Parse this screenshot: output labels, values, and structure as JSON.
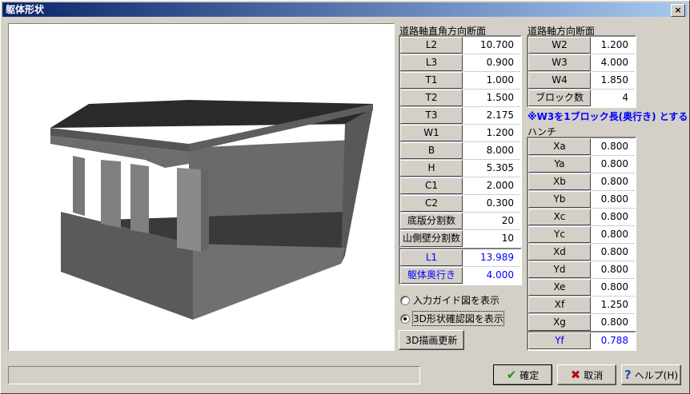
{
  "window": {
    "title": "躯体形状",
    "close": "×"
  },
  "left": {
    "heading": "道路軸直角方向断面",
    "rows": [
      {
        "label": "L2",
        "value": "10.700"
      },
      {
        "label": "L3",
        "value": "0.900"
      },
      {
        "label": "T1",
        "value": "1.000"
      },
      {
        "label": "T2",
        "value": "1.500"
      },
      {
        "label": "T3",
        "value": "2.175"
      },
      {
        "label": "W1",
        "value": "1.200"
      },
      {
        "label": "B",
        "value": "8.000"
      },
      {
        "label": "H",
        "value": "5.305"
      },
      {
        "label": "C1",
        "value": "2.000"
      },
      {
        "label": "C2",
        "value": "0.300"
      },
      {
        "label": "底版分割数",
        "value": "20"
      },
      {
        "label": "山側壁分割数",
        "value": "10"
      }
    ],
    "computed": [
      {
        "label": "L1",
        "value": "13.989"
      },
      {
        "label": "躯体奥行き",
        "value": "4.000"
      }
    ]
  },
  "right": {
    "heading": "道路軸方向断面",
    "rows": [
      {
        "label": "W2",
        "value": "1.200"
      },
      {
        "label": "W3",
        "value": "4.000"
      },
      {
        "label": "W4",
        "value": "1.850"
      },
      {
        "label": "ブロック数",
        "value": "4"
      }
    ],
    "note": "※W3を1ブロック長(奥行き) とする",
    "haunch_heading": "ハンチ",
    "haunch": [
      {
        "label": "Xa",
        "value": "0.800"
      },
      {
        "label": "Ya",
        "value": "0.800"
      },
      {
        "label": "Xb",
        "value": "0.800"
      },
      {
        "label": "Yb",
        "value": "0.800"
      },
      {
        "label": "Xc",
        "value": "0.800"
      },
      {
        "label": "Yc",
        "value": "0.800"
      },
      {
        "label": "Xd",
        "value": "0.800"
      },
      {
        "label": "Yd",
        "value": "0.800"
      },
      {
        "label": "Xe",
        "value": "0.800"
      },
      {
        "label": "Xf",
        "value": "1.250"
      },
      {
        "label": "Xg",
        "value": "0.800"
      }
    ],
    "yf": {
      "label": "Yf",
      "value": "0.788"
    }
  },
  "options": {
    "radio_guide": "入力ガイド図を表示",
    "radio_3d": "3D形状確認図を表示",
    "selected": "3d",
    "redraw": "3D描画更新"
  },
  "buttons": {
    "ok": "確定",
    "cancel": "取消",
    "help": "ヘルプ(H)"
  }
}
